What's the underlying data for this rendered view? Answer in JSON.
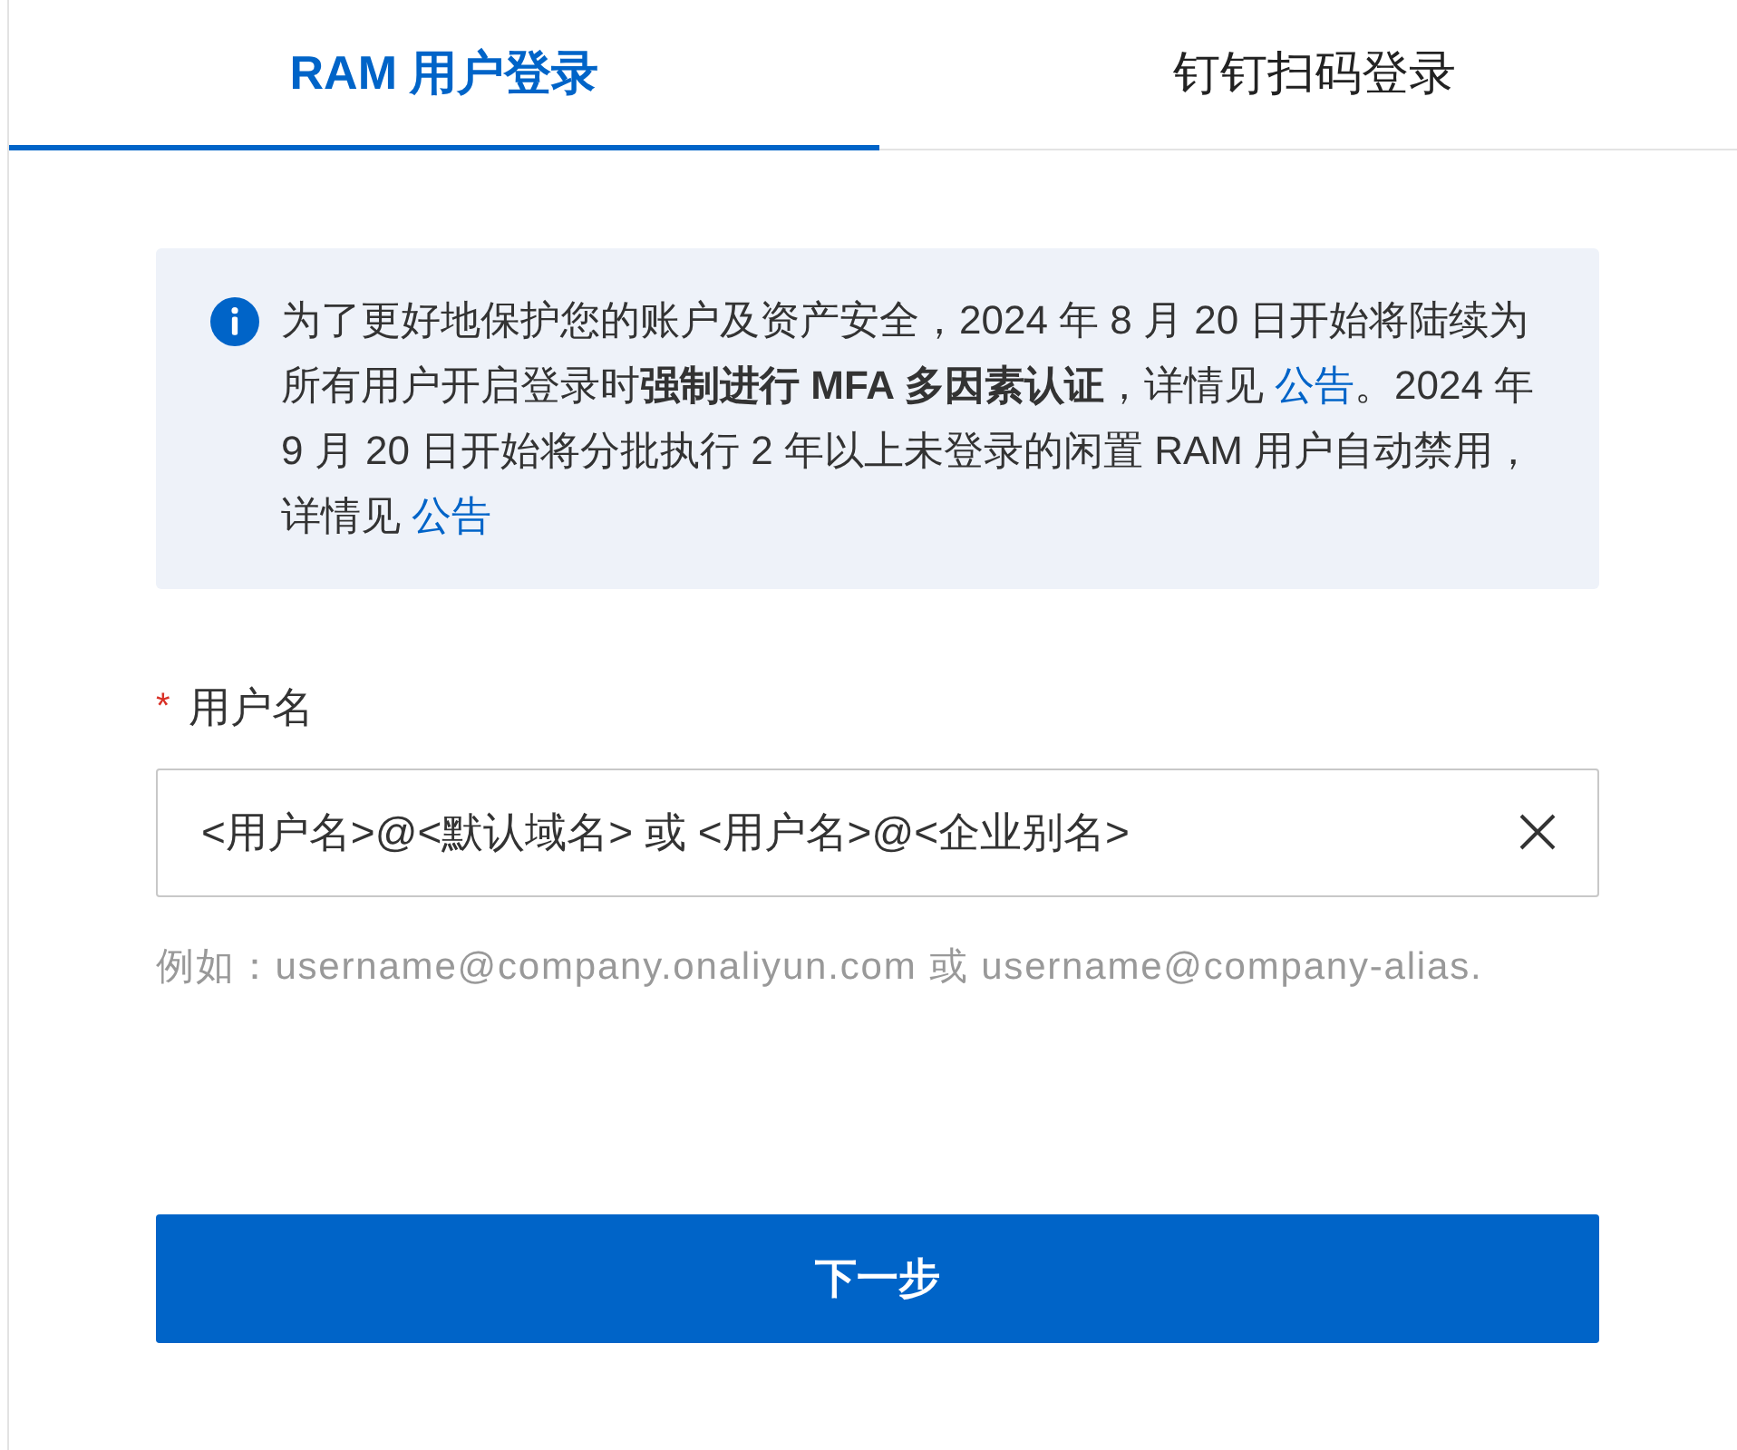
{
  "tabs": [
    {
      "label": "RAM 用户登录",
      "selected": true
    },
    {
      "label": "钉钉扫码登录",
      "selected": false
    }
  ],
  "notice": {
    "segments": [
      {
        "kind": "text",
        "text": "为了更好地保护您的账户及资产安全，2024 年 8 月 20 日开始将陆续为所有用户开启登录时**强制进行 MFA 多因素认证**，详情见 "
      },
      {
        "kind": "link",
        "text": "公告"
      },
      {
        "kind": "text",
        "text": "。2024 年 9 月 20 日开始将分批执行 2 年以上未登录的闲置 RAM 用户自动禁用，详情见 "
      },
      {
        "kind": "link",
        "text": "公告"
      }
    ]
  },
  "username": {
    "required": true,
    "required_mark": "*",
    "label": "用户名",
    "placeholder": "<用户名>@<默认域名> 或 <用户名>@<企业别名>",
    "hint": "例如：username@company.onaliyun.com 或 username@company-alias."
  },
  "next_button": "下一步"
}
